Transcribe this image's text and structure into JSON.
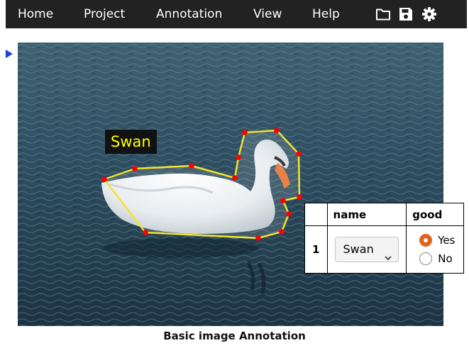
{
  "menu": {
    "items": [
      {
        "id": "home",
        "label": "Home"
      },
      {
        "id": "project",
        "label": "Project"
      },
      {
        "id": "annotation",
        "label": "Annotation"
      },
      {
        "id": "view",
        "label": "View"
      },
      {
        "id": "help",
        "label": "Help"
      }
    ],
    "icons": [
      "folder-icon",
      "save-icon",
      "gear-icon"
    ]
  },
  "region": {
    "label": "Swan",
    "shape": "polygon",
    "stroke_color": "#f2e42c",
    "vertex_color": "#ff0000"
  },
  "attribute_table": {
    "headers": {
      "id": "",
      "name": "name",
      "good": "good"
    },
    "rows": [
      {
        "id": "1",
        "name_value": "Swan",
        "good_options": [
          {
            "label": "Yes",
            "checked": true
          },
          {
            "label": "No",
            "checked": false
          }
        ]
      }
    ],
    "accent_color": "#e0641b"
  },
  "caption": "Basic image Annotation"
}
